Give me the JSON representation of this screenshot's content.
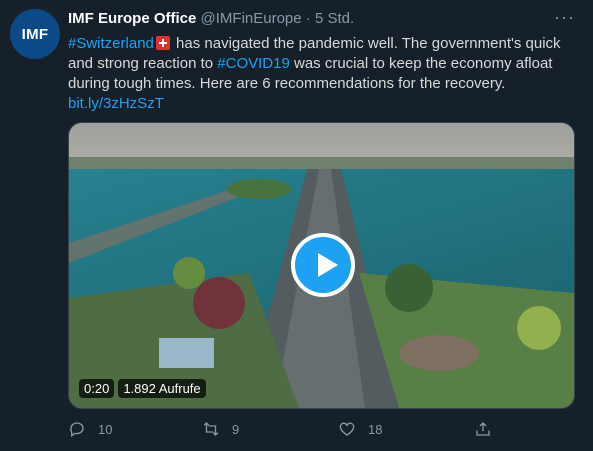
{
  "tweet": {
    "avatar_text": "IMF",
    "display_name": "IMF Europe Office",
    "handle": "@IMFinEurope",
    "separator": "·",
    "time": "5 Std.",
    "more_label": "···",
    "text": {
      "hashtag1": "#Switzerland",
      "part1": " has navigated the pandemic well. The government's quick and strong reaction to ",
      "hashtag2": "#COVID19",
      "part2": " was crucial to keep the economy afloat during tough times. Here are 6 recommendations for the recovery.",
      "link": "bit.ly/3zHzSzT"
    },
    "video": {
      "duration": "0:20",
      "views": "1.892 Aufrufe"
    },
    "actions": {
      "reply_icon": "reply-icon",
      "reply_count": "10",
      "retweet_icon": "retweet-icon",
      "retweet_count": "9",
      "like_icon": "heart-icon",
      "like_count": "18",
      "share_icon": "share-icon"
    }
  },
  "colors": {
    "background": "#15202b",
    "accent": "#1da1f2",
    "muted": "#8899a6"
  }
}
